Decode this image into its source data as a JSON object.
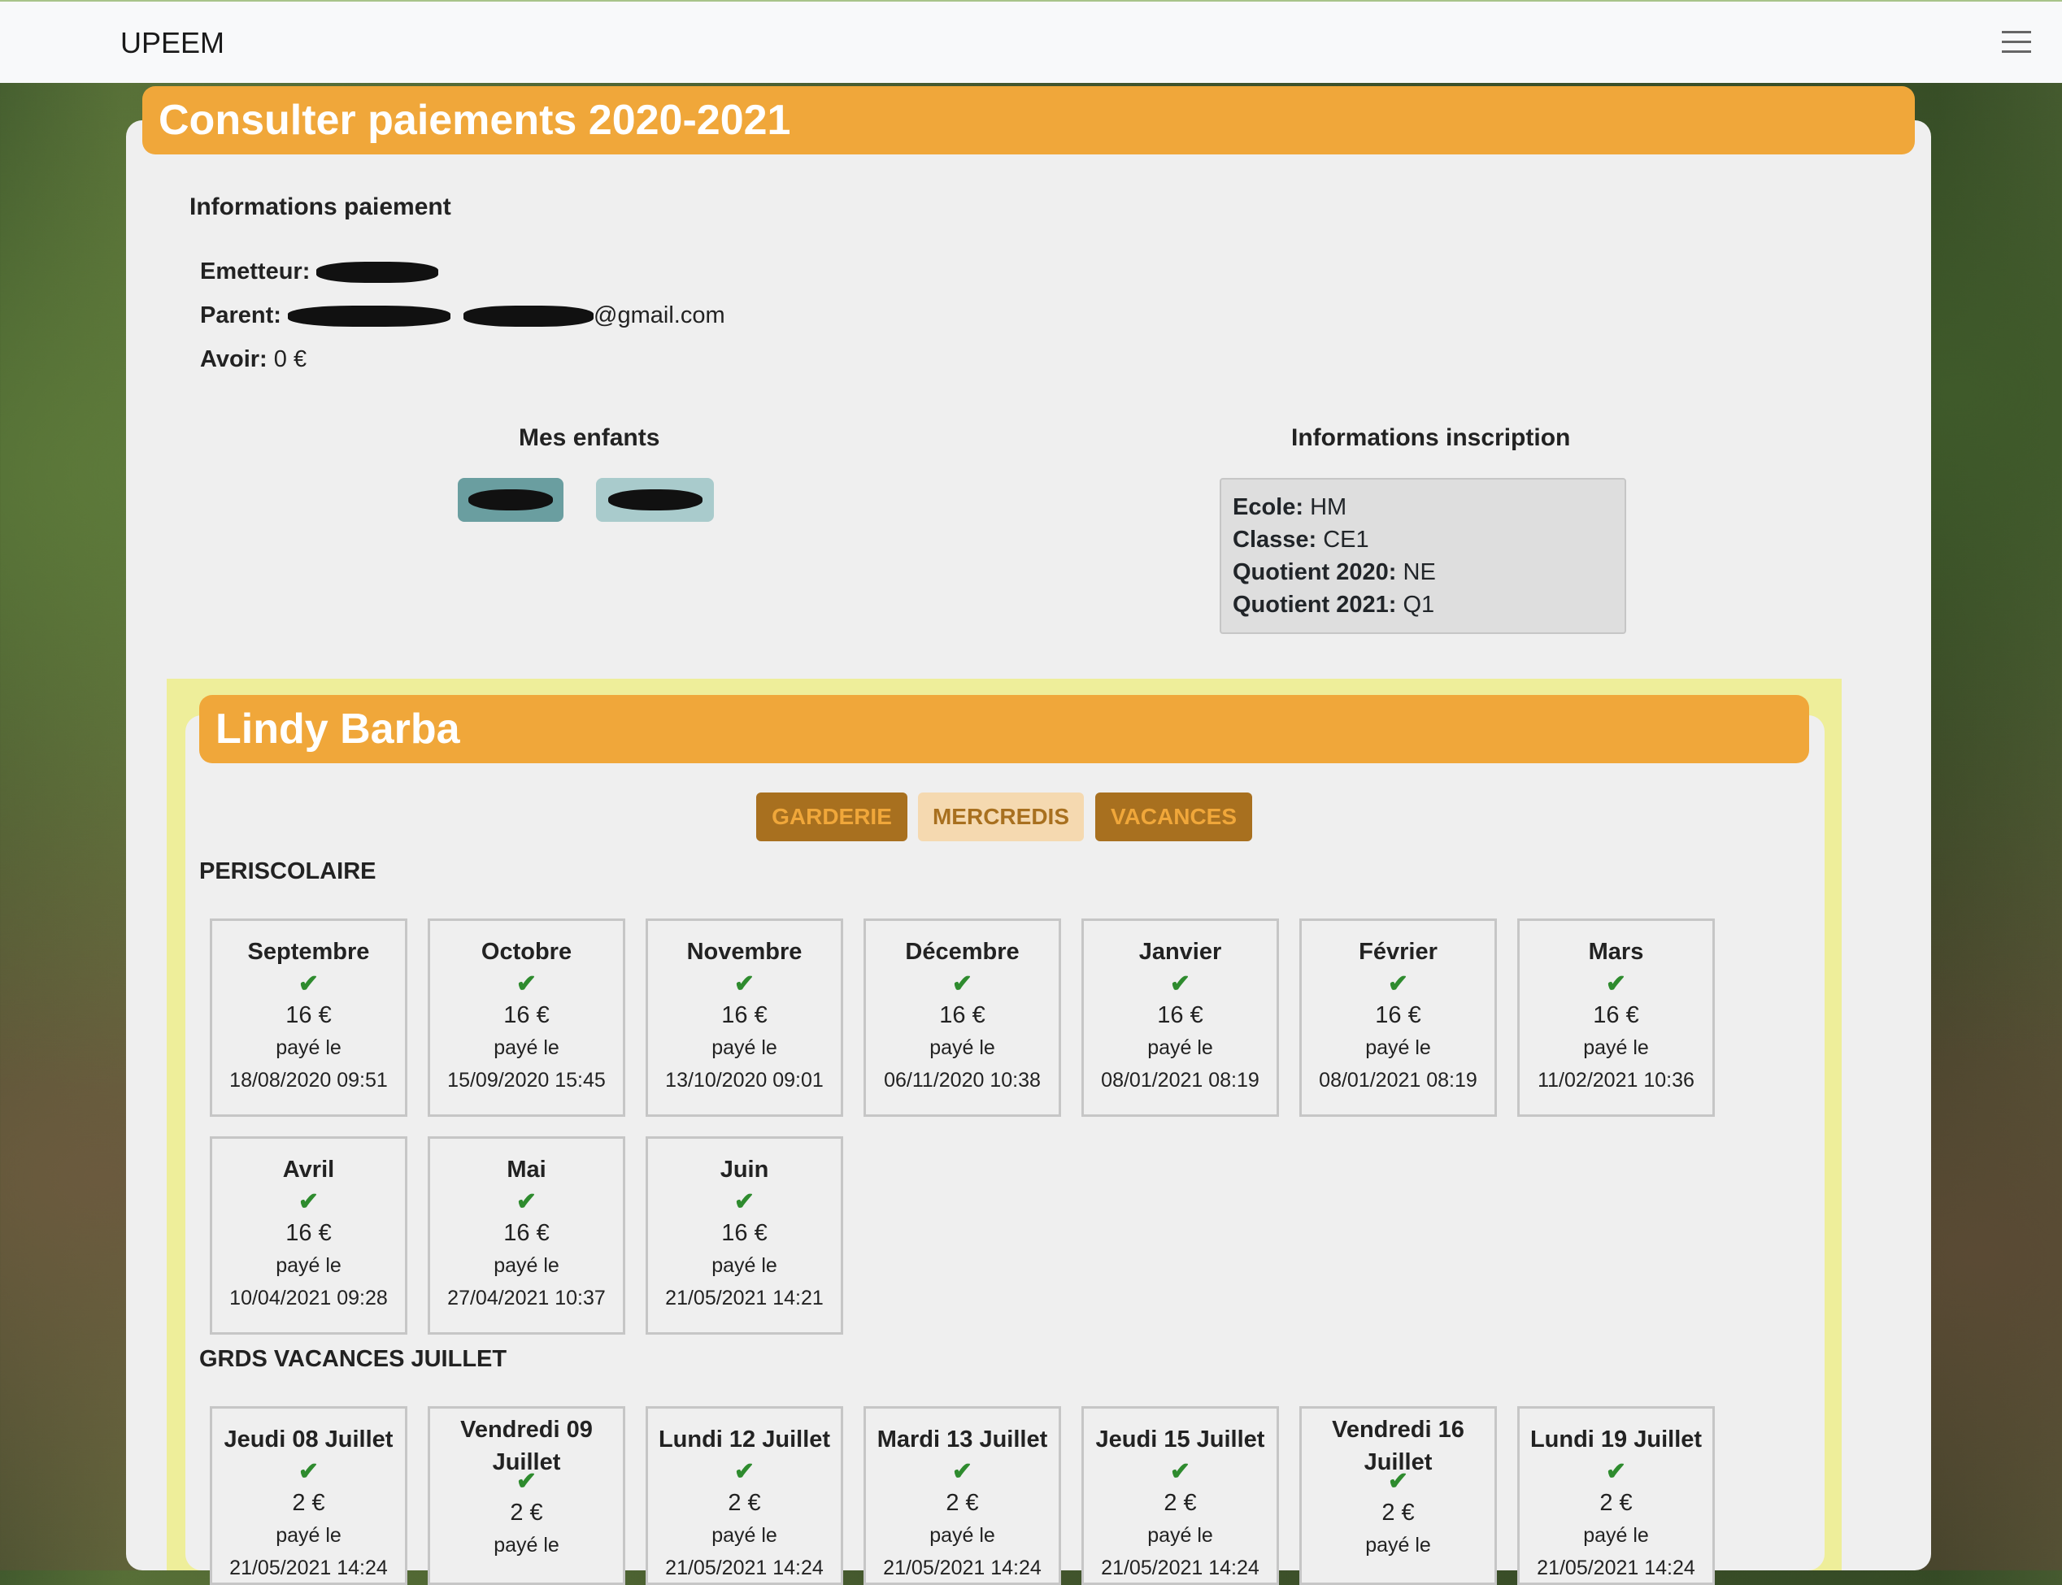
{
  "navbar": {
    "brand": "UPEEM",
    "menu_icon": "hamburger-icon"
  },
  "page_title": "Consulter paiements 2020-2021",
  "payment_info": {
    "title": "Informations paiement",
    "emetteur_label": "Emetteur:",
    "parent_label": "Parent:",
    "parent_suffix": "@gmail.com",
    "avoir_label": "Avoir:",
    "avoir_value": "0 €"
  },
  "children": {
    "title": "Mes enfants"
  },
  "inscription": {
    "title": "Informations inscription",
    "ecole_label": "Ecole:",
    "ecole": "HM",
    "classe_label": "Classe:",
    "classe": "CE1",
    "q2020_label": "Quotient 2020:",
    "q2020": "NE",
    "q2021_label": "Quotient 2021:",
    "q2021": "Q1"
  },
  "child_name": "Lindy Barba",
  "tabs": [
    "GARDERIE",
    "MERCREDIS",
    "VACANCES"
  ],
  "periscolaire": {
    "title": "PERISCOLAIRE",
    "paid_label": "payé le",
    "months": [
      {
        "name": "Septembre",
        "amount": "16 €",
        "date": "18/08/2020 09:51"
      },
      {
        "name": "Octobre",
        "amount": "16 €",
        "date": "15/09/2020 15:45"
      },
      {
        "name": "Novembre",
        "amount": "16 €",
        "date": "13/10/2020 09:01"
      },
      {
        "name": "Décembre",
        "amount": "16 €",
        "date": "06/11/2020 10:38"
      },
      {
        "name": "Janvier",
        "amount": "16 €",
        "date": "08/01/2021 08:19"
      },
      {
        "name": "Février",
        "amount": "16 €",
        "date": "08/01/2021 08:19"
      },
      {
        "name": "Mars",
        "amount": "16 €",
        "date": "11/02/2021 10:36"
      },
      {
        "name": "Avril",
        "amount": "16 €",
        "date": "10/04/2021 09:28"
      },
      {
        "name": "Mai",
        "amount": "16 €",
        "date": "27/04/2021 10:37"
      },
      {
        "name": "Juin",
        "amount": "16 €",
        "date": "21/05/2021 14:21"
      }
    ]
  },
  "vacances": {
    "title": "GRDS VACANCES JUILLET",
    "paid_label": "payé le",
    "days": [
      {
        "line1": "Jeudi 08 Juillet",
        "line2": "",
        "amount": "2 €",
        "date": "21/05/2021 14:24"
      },
      {
        "line1": "Vendredi 09",
        "line2": "Juillet",
        "amount": "2 €",
        "date": ""
      },
      {
        "line1": "Lundi 12 Juillet",
        "line2": "",
        "amount": "2 €",
        "date": "21/05/2021 14:24"
      },
      {
        "line1": "Mardi 13 Juillet",
        "line2": "",
        "amount": "2 €",
        "date": "21/05/2021 14:24"
      },
      {
        "line1": "Jeudi 15 Juillet",
        "line2": "",
        "amount": "2 €",
        "date": "21/05/2021 14:24"
      },
      {
        "line1": "Vendredi 16",
        "line2": "Juillet",
        "amount": "2 €",
        "date": ""
      },
      {
        "line1": "Lundi 19 Juillet",
        "line2": "",
        "amount": "2 €",
        "date": "21/05/2021 14:24"
      }
    ]
  },
  "check_symbol": "✔"
}
